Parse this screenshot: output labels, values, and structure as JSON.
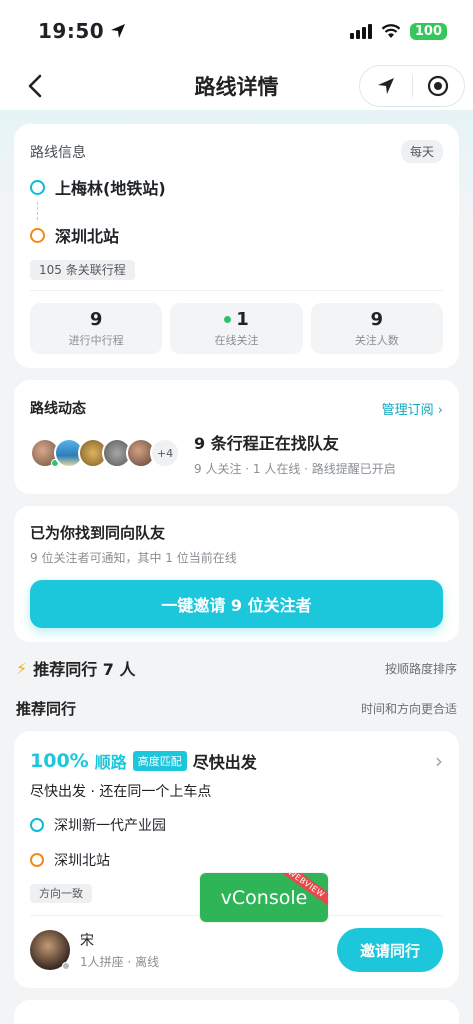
{
  "status_bar": {
    "time": "19:50",
    "battery": "100"
  },
  "nav": {
    "title": "路线详情"
  },
  "route_info": {
    "title": "路线信息",
    "frequency": "每天",
    "origin": "上梅林(地铁站)",
    "destination": "深圳北站",
    "related_trips": "105 条关联行程",
    "stats": [
      {
        "value": "9",
        "label": "进行中行程"
      },
      {
        "value": "1",
        "label": "在线关注"
      },
      {
        "value": "9",
        "label": "关注人数"
      }
    ]
  },
  "route_activity": {
    "title": "路线动态",
    "manage_link": "管理订阅",
    "more_count": "+4",
    "headline": "9 条行程正在找队友",
    "detail": "9 人关注 · 1 人在线 · 路线提醒已开启"
  },
  "found_card": {
    "title": "已为你找到同向队友",
    "subtitle": "9 位关注者可通知，其中 1 位当前在线",
    "cta": "一键邀请 9 位关注者"
  },
  "recommend_header": {
    "title": "推荐同行 7 人",
    "sort": "按顺路度排序"
  },
  "recommend_sub": {
    "title": "推荐同行",
    "note": "时间和方向更合适"
  },
  "match_card": {
    "percent": "100%",
    "match_word": "顺路",
    "tag": "高度匹配",
    "depart": "尽快出发",
    "summary": "尽快出发 · 还在同一个上车点",
    "origin": "深圳新一代产业园",
    "destination": "深圳北站",
    "direction_tag": "方向一致",
    "user_name": "宋",
    "user_meta": "1人拼座 · 离线",
    "invite": "邀请同行"
  },
  "vconsole": {
    "label": "vConsole",
    "ribbon": "WEBVIEW"
  },
  "colors": {
    "accent": "#1cc7dc",
    "origin": "#0dbccf",
    "destination": "#f08a1c",
    "online": "#2ec26a"
  }
}
